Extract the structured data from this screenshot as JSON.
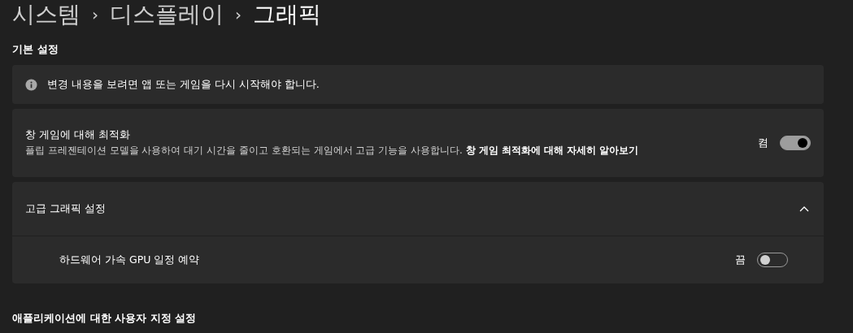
{
  "breadcrumb": [
    {
      "label": "시스템",
      "selected": false
    },
    {
      "label": "디스플레이",
      "selected": false
    },
    {
      "label": "그래픽",
      "selected": true
    }
  ],
  "breadcrumb_separator": "›",
  "sections": [
    {
      "title": "기본 설정"
    }
  ],
  "info_banner": {
    "text": "변경 내용을 보려면 앱 또는 게임을 다시 시작해야 합니다."
  },
  "window_optimization": {
    "title": "창 게임에 대해 최적화",
    "description": "플립 프레젠테이션 모델을 사용하여 대기 시간을 줄이고 호환되는 게임에서 고급 기능을 사용합니다.",
    "link": "창 게임 최적화에 대해 자세히 알아보기",
    "state_label": "켬",
    "on": true
  },
  "advanced": {
    "title": "고급 그래픽 설정",
    "expanded": true,
    "items": [
      {
        "label": "하드웨어 가속 GPU 일정 예약",
        "state_label": "끔",
        "on": false
      }
    ]
  },
  "footer_section": {
    "title": "애플리케이션에 대한 사용자 지정 설정"
  }
}
